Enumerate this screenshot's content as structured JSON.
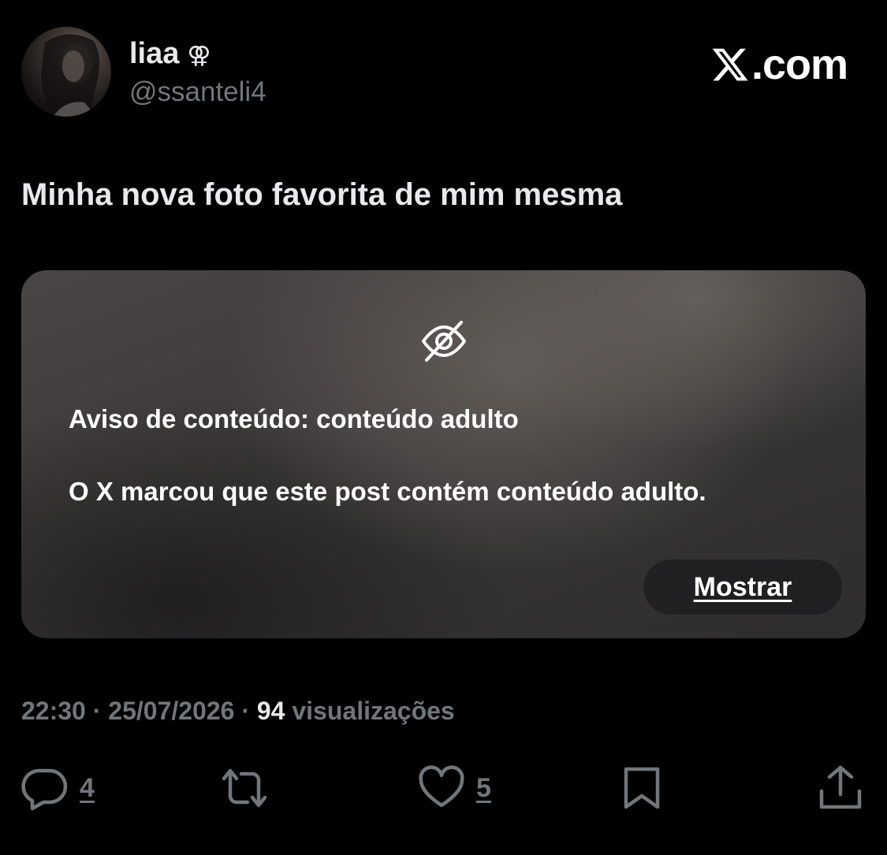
{
  "author": {
    "display_name": "liaa",
    "name_symbol": "⚢",
    "handle": "@ssanteli4"
  },
  "brand": {
    "logo_icon": "x-logo-icon",
    "suffix": ".com"
  },
  "post": {
    "text": "Minha nova foto favorita de mim mesma"
  },
  "media_warning": {
    "icon": "eye-slash-icon",
    "title": "Aviso de conteúdo: conteúdo adulto",
    "message": "O X marcou que este post contém conteúdo adulto.",
    "show_label": "Mostrar"
  },
  "meta": {
    "time": "22:30",
    "separator": "·",
    "date": "25/07/2026",
    "views_count": "94",
    "views_label": "visualizações"
  },
  "actions": {
    "reply": {
      "icon": "reply-icon",
      "count": "4"
    },
    "repost": {
      "icon": "repost-icon",
      "count": ""
    },
    "like": {
      "icon": "heart-icon",
      "count": "5"
    },
    "bookmark": {
      "icon": "bookmark-icon",
      "count": ""
    },
    "share": {
      "icon": "share-icon",
      "count": ""
    }
  },
  "colors": {
    "background": "#000000",
    "primary_text": "#e7e9ea",
    "secondary_text": "#71767b",
    "warning_text": "#ffffff"
  }
}
